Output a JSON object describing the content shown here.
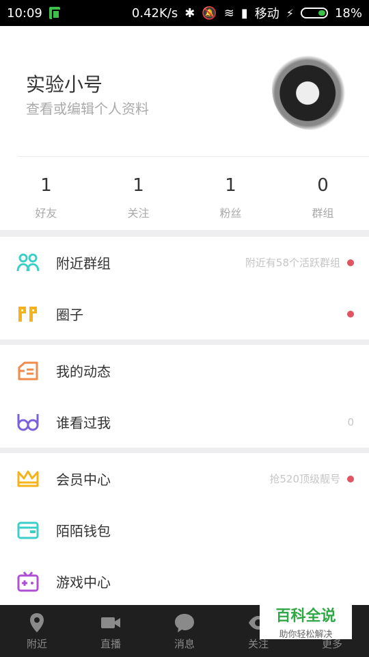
{
  "status_bar": {
    "time": "10:09",
    "network_speed": "0.42K/s",
    "carrier": "移动",
    "battery": "18%",
    "icons": [
      "sim-icon",
      "bluetooth-icon",
      "mute-icon",
      "wifi-icon",
      "signal-icon",
      "charging-icon",
      "battery-icon"
    ]
  },
  "profile": {
    "name": "实验小号",
    "subtitle": "查看或编辑个人资料"
  },
  "stats": [
    {
      "value": "1",
      "label": "好友"
    },
    {
      "value": "1",
      "label": "关注"
    },
    {
      "value": "1",
      "label": "粉丝"
    },
    {
      "value": "0",
      "label": "群组"
    }
  ],
  "menu": {
    "nearby_groups": {
      "label": "附近群组",
      "hint": "附近有58个活跃群组",
      "icon": "group-icon",
      "color": "#3ccfc9"
    },
    "circle": {
      "label": "圈子",
      "hint": "",
      "icon": "quote-icon",
      "color": "#f5b21a"
    },
    "my_feed": {
      "label": "我的动态",
      "hint": "",
      "icon": "feed-icon",
      "color": "#f18a4a"
    },
    "visitors": {
      "label": "谁看过我",
      "hint": "0",
      "icon": "glasses-icon",
      "color": "#7a5fdc"
    },
    "vip": {
      "label": "会员中心",
      "hint": "抢520顶级靓号",
      "icon": "crown-icon",
      "color": "#f5b21a"
    },
    "wallet": {
      "label": "陌陌钱包",
      "hint": "",
      "icon": "wallet-icon",
      "color": "#3ccfc9"
    },
    "games": {
      "label": "游戏中心",
      "hint": "",
      "icon": "gamepad-icon",
      "color": "#b04fd6"
    }
  },
  "bottom_nav": [
    {
      "label": "附近",
      "icon": "location-pin-icon"
    },
    {
      "label": "直播",
      "icon": "video-camera-icon"
    },
    {
      "label": "消息",
      "icon": "chat-bubble-icon"
    },
    {
      "label": "关注",
      "icon": "eye-icon"
    },
    {
      "label": "更多",
      "icon": "more-icon"
    }
  ],
  "watermark": {
    "title": "百科全说",
    "subtitle": "助你轻松解决"
  },
  "colors": {
    "badge_dot": "#e05561",
    "section_gap": "#eeeef1",
    "nav_bg": "#1f1f1f"
  }
}
